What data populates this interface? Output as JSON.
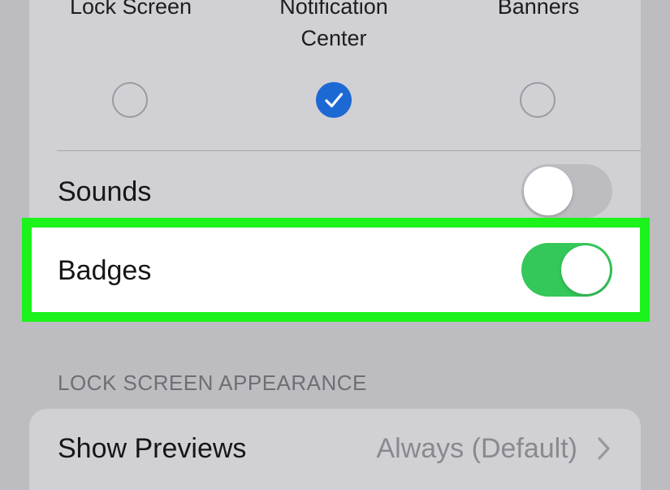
{
  "alert_options": [
    {
      "label_line1": "Lock Screen",
      "label_line2": "",
      "selected": false,
      "icon": "radio-empty"
    },
    {
      "label_line1": "Notification",
      "label_line2": "Center",
      "selected": true,
      "icon": "checkmark-icon"
    },
    {
      "label_line1": "Banners",
      "label_line2": "",
      "selected": false,
      "icon": "radio-empty"
    }
  ],
  "sounds": {
    "label": "Sounds",
    "enabled": false,
    "toggle_color": "#bdbcc1"
  },
  "badges": {
    "label": "Badges",
    "enabled": true,
    "toggle_color": "#34c759"
  },
  "highlight_color": "#1cf21c",
  "accent_color": "#1c69d4",
  "lock_screen_appearance": {
    "header": "LOCK SCREEN APPEARANCE",
    "show_previews": {
      "label": "Show Previews",
      "value": "Always (Default)",
      "icon": "chevron-right-icon"
    }
  }
}
